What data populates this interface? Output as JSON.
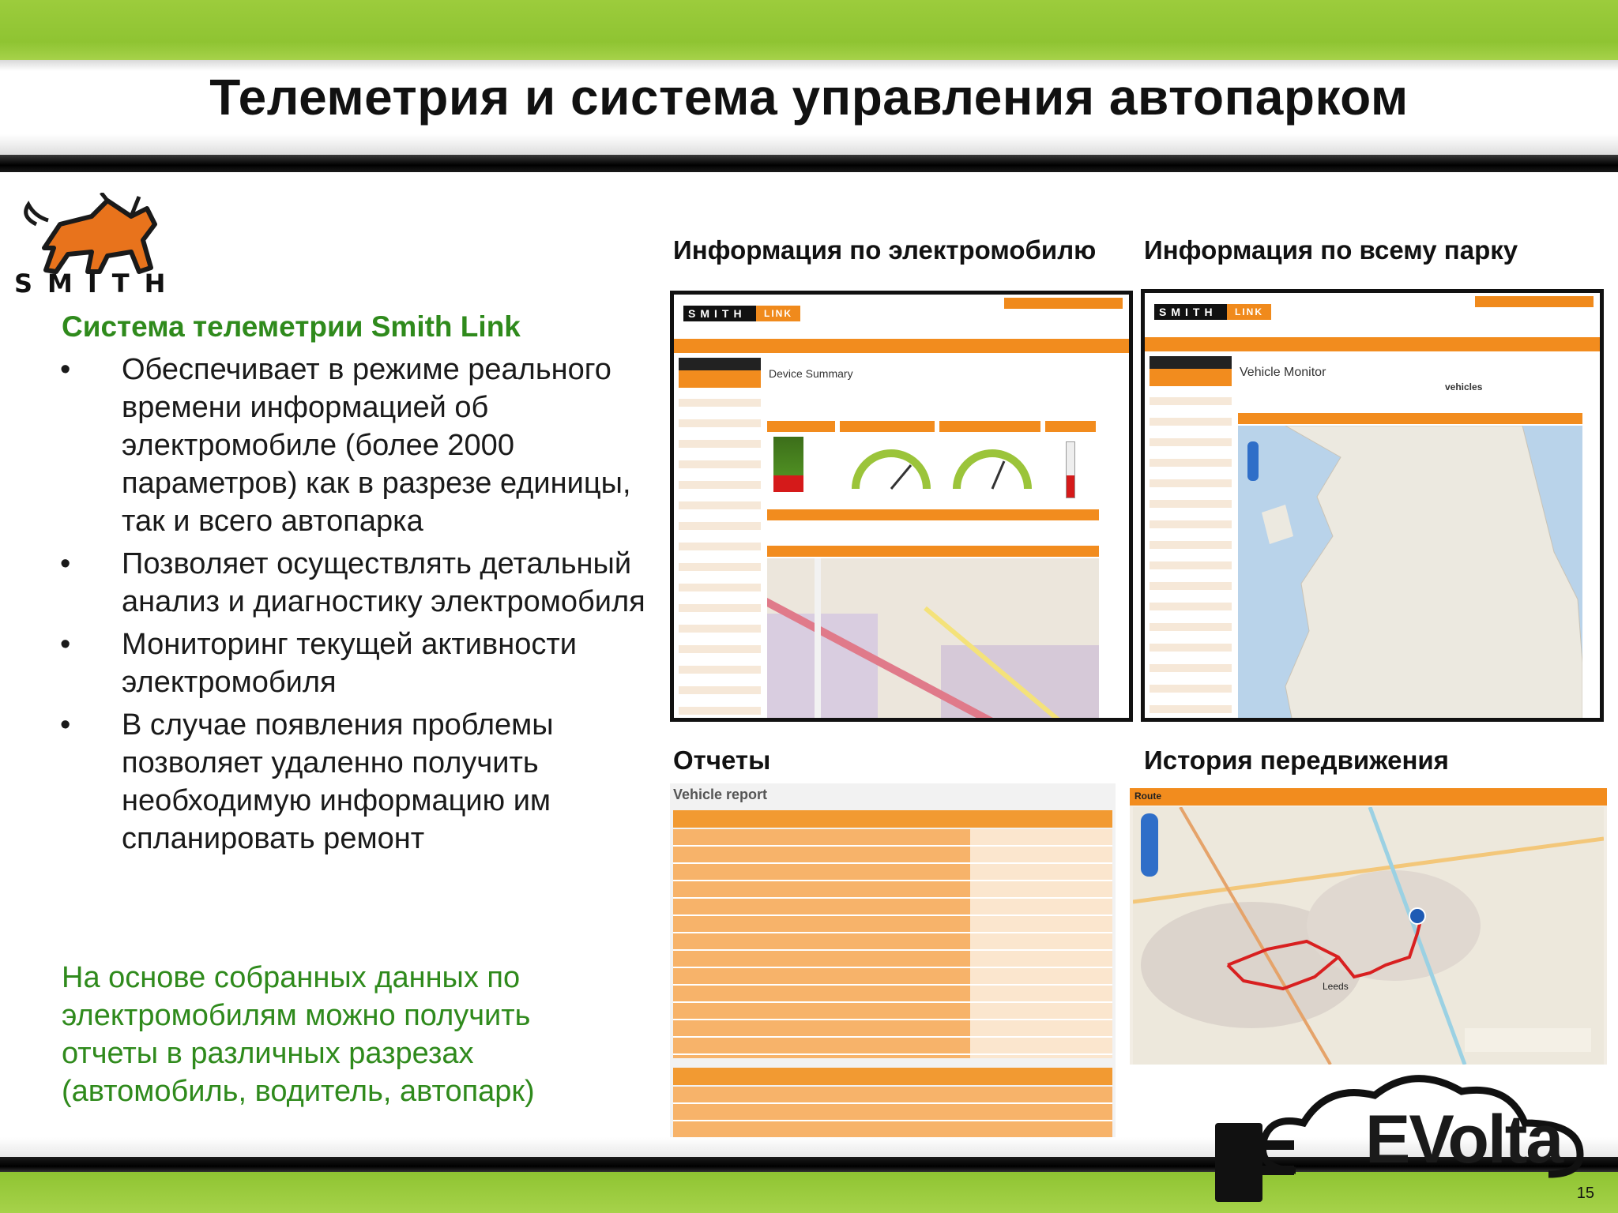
{
  "title": "Телеметрия и система управления автопарком",
  "brand": {
    "word": "SMITH",
    "logo_icon": "griffin-logo-icon"
  },
  "left": {
    "heading": "Система телеметрии Smith Link",
    "bullet_glyph": "•",
    "bullets": [
      "Обеспечивает в режиме реального времени информацией об электромобиле (более 2000 параметров) как в разрезе единицы, так и всего автопарка",
      "Позволяет осуществлять детальный анализ и диагностику электромобиля",
      "Мониторинг текущей активности электромобиля",
      "В случае появления проблемы позволяет удаленно получить необходимую информацию им спланировать ремонт"
    ],
    "footer": "На основе собранных данных по электромобилям можно получить отчеты в различных разрезах (автомобиль, водитель, автопарк)"
  },
  "panels": {
    "vehicle": {
      "label": "Информация по электромобилю",
      "app_name": "SMITH",
      "app_tag": "LINK",
      "content_title": "Device Summary"
    },
    "fleet": {
      "label": "Информация по всему парку",
      "app_name": "SMITH",
      "app_tag": "LINK",
      "content_title": "Vehicle Monitor",
      "sub_label": "vehicles"
    },
    "reports": {
      "label": "Отчеты",
      "content_title": "Vehicle report"
    },
    "history": {
      "label": "История передвижения",
      "map_title": "Route",
      "city_label": "Leeds"
    }
  },
  "footer_brand": {
    "name": "EVolta",
    "icon": "plug-cloud-logo-icon"
  },
  "page_number": "15",
  "colors": {
    "green": "#8fc432",
    "brand_green_text": "#2f8a1c",
    "orange": "#f28c1e"
  }
}
